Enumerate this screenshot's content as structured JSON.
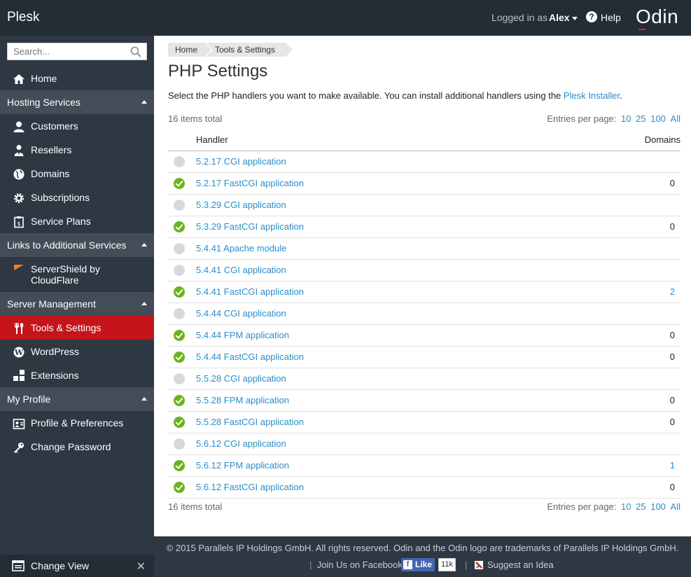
{
  "topbar": {
    "brand": "Plesk",
    "logged_in_as": "Logged in as",
    "user": "Alex",
    "help": "Help",
    "vendor_logo": "Odin"
  },
  "sidebar": {
    "search_placeholder": "Search...",
    "home": "Home",
    "sections": [
      {
        "title": "Hosting Services",
        "items": [
          "Customers",
          "Resellers",
          "Domains",
          "Subscriptions",
          "Service Plans"
        ]
      },
      {
        "title": "Links to Additional Services",
        "items": [
          "ServerShield by",
          "CloudFlare"
        ]
      },
      {
        "title": "Server Management",
        "items": [
          "Tools & Settings",
          "WordPress",
          "Extensions"
        ]
      },
      {
        "title": "My Profile",
        "items": [
          "Profile & Preferences",
          "Change Password"
        ]
      }
    ],
    "change_view": "Change View"
  },
  "breadcrumb": [
    "Home",
    "Tools & Settings"
  ],
  "page": {
    "title": "PHP Settings",
    "description_prefix": "Select the PHP handlers you want to make available. You can install additional handlers using the",
    "description_link": "Plesk Installer",
    "description_suffix": ".",
    "total": "16 items total",
    "entries_label": "Entries per page:",
    "entries_options": [
      "10",
      "25",
      "100",
      "All"
    ]
  },
  "table": {
    "headers": [
      "Handler",
      "Domains"
    ],
    "rows": [
      {
        "name": "5.2.17 CGI application",
        "enabled": false,
        "domains": ""
      },
      {
        "name": "5.2.17 FastCGI application",
        "enabled": true,
        "domains": "0"
      },
      {
        "name": "5.3.29 CGI application",
        "enabled": false,
        "domains": ""
      },
      {
        "name": "5.3.29 FastCGI application",
        "enabled": true,
        "domains": "0"
      },
      {
        "name": "5.4.41 Apache module",
        "enabled": false,
        "domains": ""
      },
      {
        "name": "5.4.41 CGI application",
        "enabled": false,
        "domains": ""
      },
      {
        "name": "5.4.41 FastCGI application",
        "enabled": true,
        "domains": "2"
      },
      {
        "name": "5.4.44 CGI application",
        "enabled": false,
        "domains": ""
      },
      {
        "name": "5.4.44 FPM application",
        "enabled": true,
        "domains": "0"
      },
      {
        "name": "5.4.44 FastCGI application",
        "enabled": true,
        "domains": "0"
      },
      {
        "name": "5.5.28 CGI application",
        "enabled": false,
        "domains": ""
      },
      {
        "name": "5.5.28 FPM application",
        "enabled": true,
        "domains": "0"
      },
      {
        "name": "5.5.28 FastCGI application",
        "enabled": true,
        "domains": "0"
      },
      {
        "name": "5.6.12 CGI application",
        "enabled": false,
        "domains": ""
      },
      {
        "name": "5.6.12 FPM application",
        "enabled": true,
        "domains": "1"
      },
      {
        "name": "5.6.12 FastCGI application",
        "enabled": true,
        "domains": "0"
      }
    ]
  },
  "footer": {
    "copyright": "© 2015 Parallels IP Holdings GmbH. All rights reserved. Odin and the Odin logo are trademarks of Parallels IP Holdings GmbH.",
    "facebook": "Join Us on Facebook",
    "like": "Like",
    "like_count": "11k",
    "suggest": "Suggest an Idea"
  },
  "colors": {
    "accent_link": "#2b8dc9",
    "active_nav": "#c5151a",
    "enabled_status": "#6ab31d",
    "disabled_status": "#d6d9dc"
  }
}
